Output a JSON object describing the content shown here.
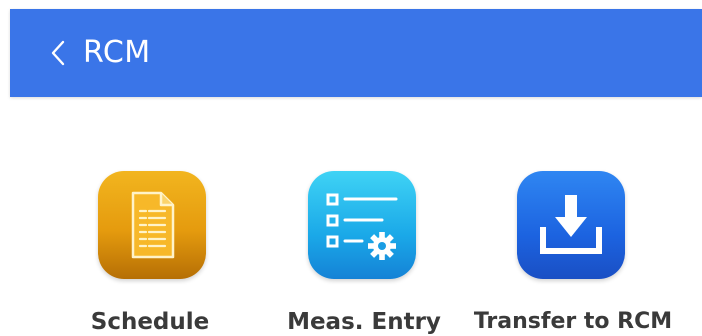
{
  "appbar": {
    "title": "RCM",
    "back_icon": "chevron-left-icon",
    "color": "#3a75e8"
  },
  "tiles": [
    {
      "label": "Schedule",
      "icon": "document-icon",
      "color": "#e59b0e"
    },
    {
      "label": "Meas. Entry",
      "icon": "list-settings-icon",
      "color": "#1aa8e8"
    },
    {
      "label": "Transfer to RCM",
      "icon": "download-tray-icon",
      "color": "#1c63e0"
    }
  ]
}
